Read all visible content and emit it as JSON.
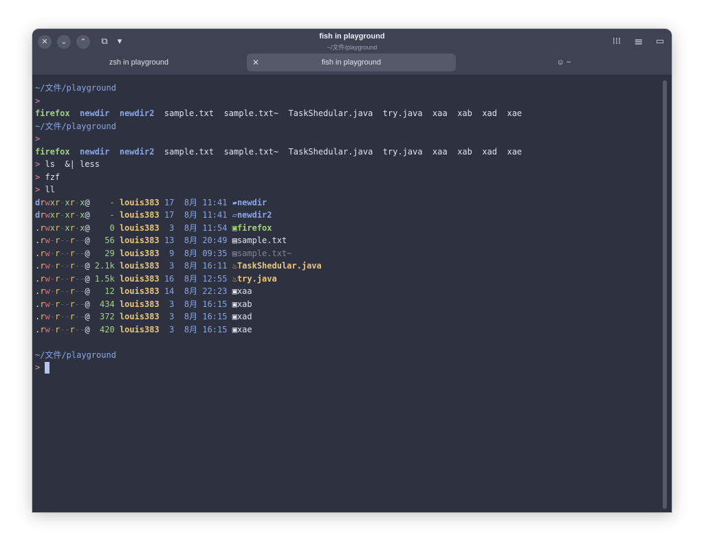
{
  "window": {
    "title": "fish in playground",
    "subtitle": "~/文件/playground",
    "close_icon": "✕",
    "down_icon": "⌄",
    "up_icon": "⌃",
    "new_tab_icon": "⧉",
    "dropdown_icon": "▾",
    "grid_icon": "⁞⁞⁞",
    "menu_icon": "≡",
    "terminal_icon": "▭"
  },
  "tabs": [
    {
      "label": "zsh in playground"
    },
    {
      "label": "fish in playground",
      "close_icon": "✕"
    },
    {
      "label": "~",
      "icon": "☺"
    }
  ],
  "terminal": {
    "path": "~/文件/playground",
    "prompt": ">",
    "ls_files": [
      "firefox",
      "newdir",
      "newdir2",
      "sample.txt",
      "sample.txt~",
      "TaskShedular.java",
      "try.java",
      "xaa",
      "xab",
      "xad",
      "xae"
    ],
    "cmd_ls_less": "ls  &| less",
    "cmd_fzf": "fzf",
    "cmd_ll": "ll",
    "ll_rows": [
      {
        "perm": "drwxr-xr-x@",
        "size": "-",
        "user": "louis383",
        "day": "17",
        "month": "8月",
        "time": "11:41",
        "icon": "▰",
        "name": "newdir"
      },
      {
        "perm": "drwxr-xr-x@",
        "size": "-",
        "user": "louis383",
        "day": "17",
        "month": "8月",
        "time": "11:41",
        "icon": "▱",
        "name": "newdir2"
      },
      {
        "perm": ".rwxr-xr-x@",
        "size": "0",
        "user": "louis383",
        "day": "3",
        "month": "8月",
        "time": "11:54",
        "icon": "▣",
        "name": "firefox"
      },
      {
        "perm": ".rw-r--r--@",
        "size": "56",
        "user": "louis383",
        "day": "13",
        "month": "8月",
        "time": "20:49",
        "icon": "▤",
        "name": "sample.txt"
      },
      {
        "perm": ".rw-r--r--@",
        "size": "29",
        "user": "louis383",
        "day": "9",
        "month": "8月",
        "time": "09:35",
        "icon": "▤",
        "name": "sample.txt~"
      },
      {
        "perm": ".rw-r--r--@",
        "size": "2.1k",
        "user": "louis383",
        "day": "3",
        "month": "8月",
        "time": "16:11",
        "icon": "♨",
        "name": "TaskShedular.java"
      },
      {
        "perm": ".rw-r--r--@",
        "size": "1.5k",
        "user": "louis383",
        "day": "16",
        "month": "8月",
        "time": "12:55",
        "icon": "♨",
        "name": "try.java"
      },
      {
        "perm": ".rw-r--r--@",
        "size": "12",
        "user": "louis383",
        "day": "14",
        "month": "8月",
        "time": "22:23",
        "icon": "▣",
        "name": "xaa"
      },
      {
        "perm": ".rw-r--r--@",
        "size": "434",
        "user": "louis383",
        "day": "3",
        "month": "8月",
        "time": "16:15",
        "icon": "▣",
        "name": "xab"
      },
      {
        "perm": ".rw-r--r--@",
        "size": "372",
        "user": "louis383",
        "day": "3",
        "month": "8月",
        "time": "16:15",
        "icon": "▣",
        "name": "xad"
      },
      {
        "perm": ".rw-r--r--@",
        "size": "420",
        "user": "louis383",
        "day": "3",
        "month": "8月",
        "time": "16:15",
        "icon": "▣",
        "name": "xae"
      }
    ]
  }
}
